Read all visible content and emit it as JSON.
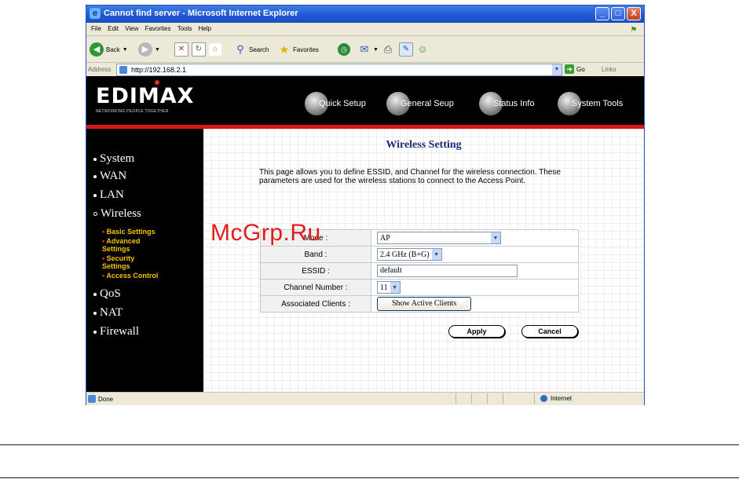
{
  "window": {
    "title": "Cannot find server - Microsoft Internet Explorer",
    "buttons": {
      "minimize": "_",
      "maximize": "□",
      "close": "X"
    }
  },
  "menu": [
    "File",
    "Edit",
    "View",
    "Favorites",
    "Tools",
    "Help"
  ],
  "toolbar": {
    "back": "Back",
    "search": "Search",
    "favorites": "Favorites"
  },
  "address": {
    "label": "Address",
    "url": "http://192.168.2.1",
    "go": "Go",
    "links": "Links"
  },
  "banner": {
    "logo": "EDIMAX",
    "tagline": "NETWORKING PEOPLE TOGETHER",
    "nav": [
      "Quick Setup",
      "General Seup",
      "Status Info",
      "System Tools"
    ]
  },
  "sidebar": {
    "items": [
      "System",
      "WAN",
      "LAN",
      "Wireless",
      "QoS",
      "NAT",
      "Firewall"
    ],
    "wireless_sub": [
      "Basic Settings",
      "Advanced Settings",
      "Security Settings",
      "Access Control"
    ]
  },
  "main": {
    "heading": "Wireless Setting",
    "description": "This page allows you to define ESSID, and Channel for the wireless connection. These parameters are used for the wireless stations to connect to the Access Point.",
    "rows": {
      "mode_label": "Mode :",
      "mode_value": "AP",
      "band_label": "Band :",
      "band_value": "2.4 GHz (B+G)",
      "essid_label": "ESSID :",
      "essid_value": "default",
      "channel_label": "Channel Number :",
      "channel_value": "11",
      "clients_label": "Associated Clients :",
      "clients_button": "Show Active Clients"
    },
    "apply": "Apply",
    "cancel": "Cancel"
  },
  "status": {
    "text": "Done",
    "zone": "Internet"
  },
  "watermark": "McGrp.Ru"
}
